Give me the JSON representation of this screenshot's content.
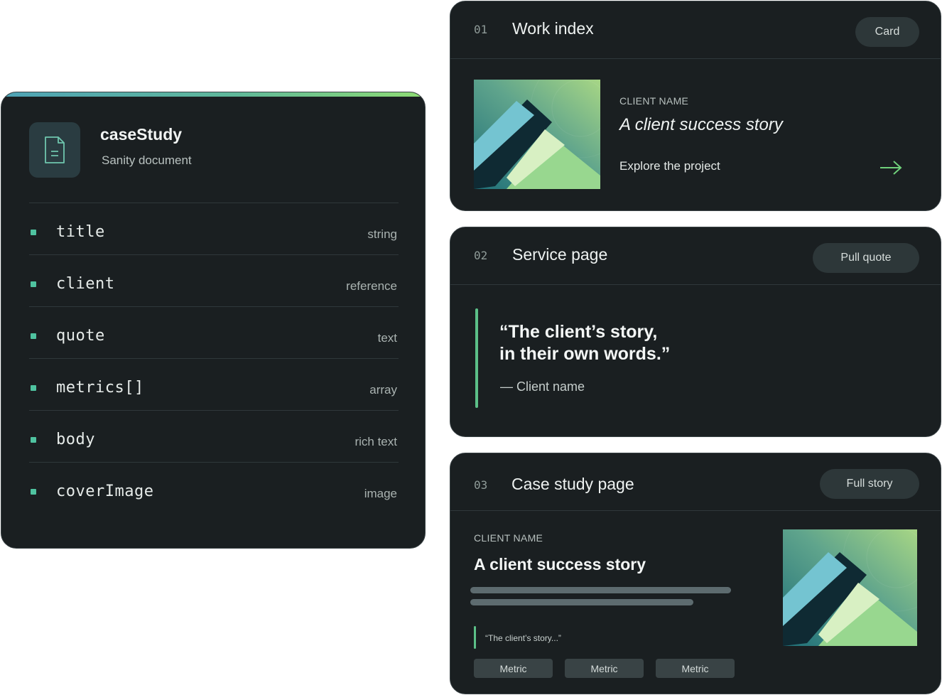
{
  "schema": {
    "title": "caseStudy",
    "subtitle": "Sanity document",
    "icon": "document-icon",
    "fields": [
      {
        "name": "title",
        "type": "string"
      },
      {
        "name": "client",
        "type": "reference"
      },
      {
        "name": "quote",
        "type": "text"
      },
      {
        "name": "metrics[]",
        "type": "array"
      },
      {
        "name": "body",
        "type": "rich text"
      },
      {
        "name": "coverImage",
        "type": "image"
      }
    ]
  },
  "panels": [
    {
      "number": "01",
      "title": "Work index",
      "button": "Card",
      "eyebrow": "CLIENT NAME",
      "story": "A client success story",
      "link": "Explore the project",
      "link_icon": "arrow-right-icon"
    },
    {
      "number": "02",
      "title": "Service page",
      "button": "Pull quote",
      "quote": "“The client’s story,\nin their own words.”",
      "attribution": "— Client name"
    },
    {
      "number": "03",
      "title": "Case study page",
      "button": "Full story",
      "eyebrow": "CLIENT NAME",
      "story": "A client success story",
      "mini_quote": "“The client’s story...”",
      "metrics": [
        "Metric",
        "Metric",
        "Metric"
      ]
    }
  ],
  "colors": {
    "panel_bg": "#1a1f21",
    "accent_green": "#5cc088",
    "gradient_start": "#4fa3b6",
    "gradient_end": "#8fdc74"
  }
}
